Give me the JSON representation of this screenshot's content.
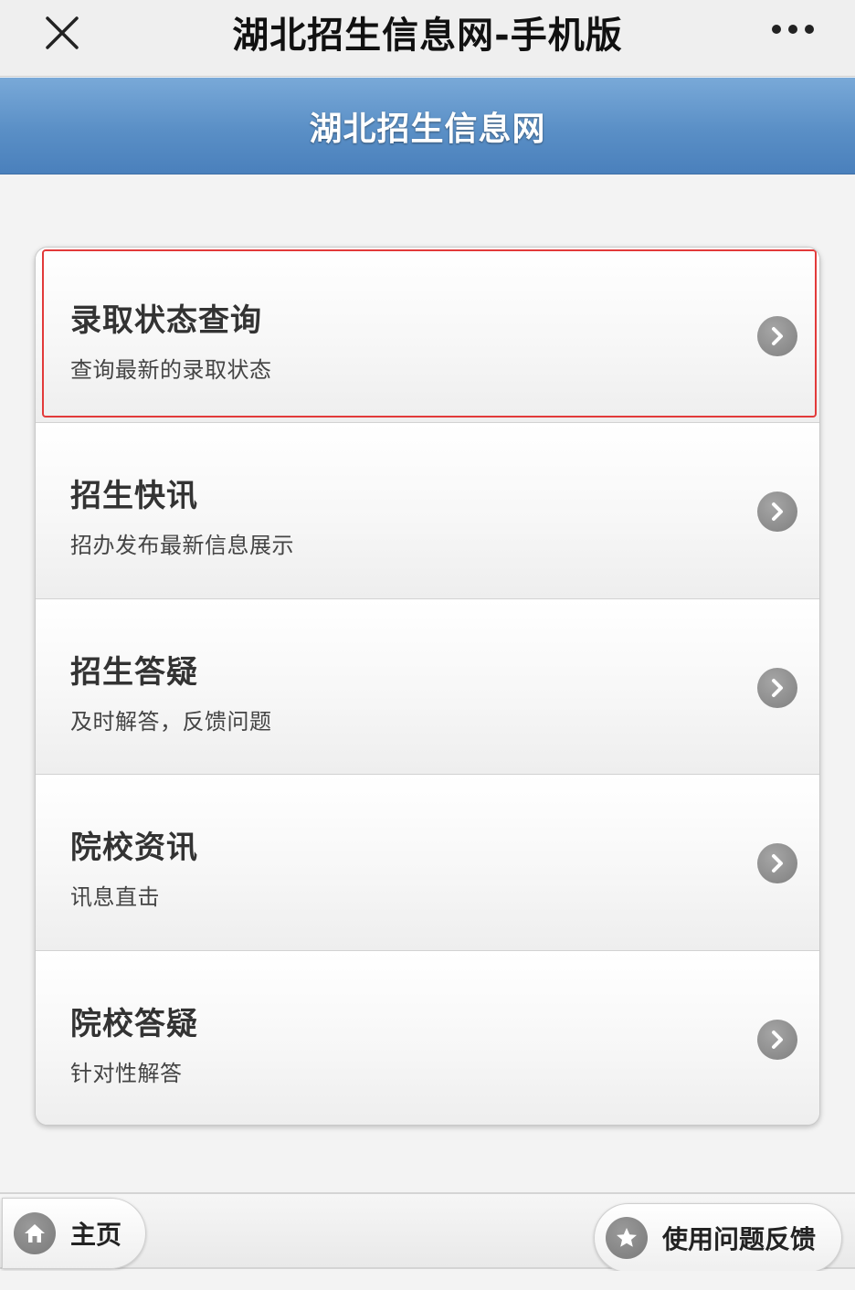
{
  "topbar": {
    "title": "湖北招生信息网-手机版",
    "close_icon": "close-icon",
    "more_icon": "more-dots-icon"
  },
  "header": {
    "title": "湖北招生信息网",
    "background_color": "#5a8fc6"
  },
  "menu": {
    "items": [
      {
        "title": "录取状态查询",
        "subtitle": "查询最新的录取状态",
        "highlighted": true,
        "icon": "chevron-right-icon"
      },
      {
        "title": "招生快讯",
        "subtitle": "招办发布最新信息展示",
        "highlighted": false,
        "icon": "chevron-right-icon"
      },
      {
        "title": "招生答疑",
        "subtitle": "及时解答，反馈问题",
        "highlighted": false,
        "icon": "chevron-right-icon"
      },
      {
        "title": "院校资讯",
        "subtitle": "讯息直击",
        "highlighted": false,
        "icon": "chevron-right-icon"
      },
      {
        "title": "院校答疑",
        "subtitle": "针对性解答",
        "highlighted": false,
        "icon": "chevron-right-icon"
      }
    ],
    "highlight_color": "#e23a3a"
  },
  "bottombar": {
    "home_label": "主页",
    "home_icon": "home-icon",
    "feedback_label": "使用问题反馈",
    "feedback_icon": "star-icon"
  }
}
